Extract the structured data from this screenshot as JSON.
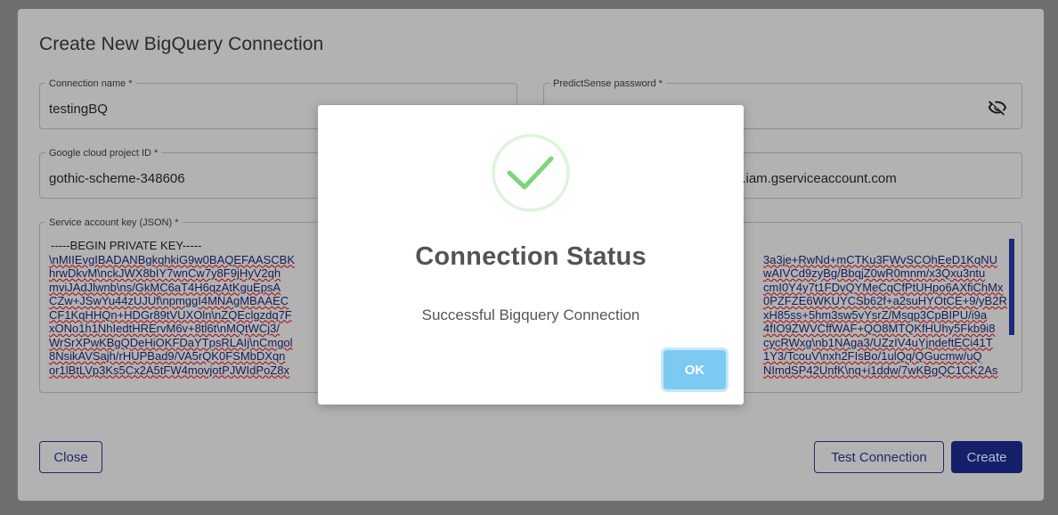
{
  "dialog": {
    "title": "Create New BigQuery Connection",
    "fields": {
      "connection_name": {
        "label": "Connection name *",
        "value": "testingBQ"
      },
      "password": {
        "label": "PredictSense password *",
        "value": ""
      },
      "project_id": {
        "label": "Google cloud project ID *",
        "value": "gothic-scheme-348606"
      },
      "service_account_email": {
        "value": "6.iam.gserviceaccount.com"
      },
      "service_key": {
        "label": "Service account key (JSON) *",
        "header": "-----BEGIN PRIVATE KEY-----",
        "left_lines": [
          "\\nMIIEvgIBADANBgkqhkiG9w0BAQEFAASCBK",
          "hrwDkvM\\nckJWX8bIY7wnCw7y8F9jHyV2qh",
          "mviJAdJlwnb\\ns/GkMC6aT4H6qzAtKguEpsA",
          "CZw+JSwYu44zUJUf\\npmggI4MNAgMBAAEC",
          "CF1KqHHQn+HDGr89tVUXOln\\nZQEclgzdq7F",
          "xONo1h1NhIedtHRErvM6v+8tl6t\\nMQtWCj3/",
          "WrSrXPwKBgQDeHiOKFDaYTpsRLAIj\\nCmgol",
          "8NsikAVSajh/rHUPBad9/VA5rQK0FSMbDXqn",
          "or1lBtLVp3Ks5Cx2A5tFW4movjotPJWIdPoZ8x"
        ],
        "right_lines": [
          "3a3je+RwNd+mCTKu3FWvSCOhEeD1KqNU",
          "wAIVCd9zyBg/BbqjZ0wR0mnm/x3Qxu3ntu",
          "cmI0Y4y7t1FDvQYMeCqCfPtUHpo6AXfiChMx",
          "0PZFZE6WKUYCSb62f+a2suHYOtCE+9/yB2R",
          "xH85ss+5hm3sw5vYsrZ/Msqp3CpBIPU/i9a",
          "4fIO9ZWVCffWAF+QO8MTQKfHUhy5Fkb9i8",
          "cycRWxg\\nb1NAga3/UZzIV4uYjndeftECi41T",
          "1Y3/TcouV\\nxh2FIsBo/1ulQq/QGucmw/uQ",
          "NImdSP42UnfK\\nq+i1ddw/7wKBgQC1CK2As"
        ]
      }
    },
    "buttons": {
      "close": "Close",
      "test_connection": "Test Connection",
      "create": "Create"
    }
  },
  "modal": {
    "icon": "check-circle-icon",
    "title": "Connection Status",
    "message": "Successful Bigquery Connection",
    "ok_label": "OK"
  },
  "colors": {
    "primary": "#14206a",
    "ok_button": "#7cc9f2",
    "success_check": "#7dd67a",
    "overlay": "#6f6f6f"
  }
}
